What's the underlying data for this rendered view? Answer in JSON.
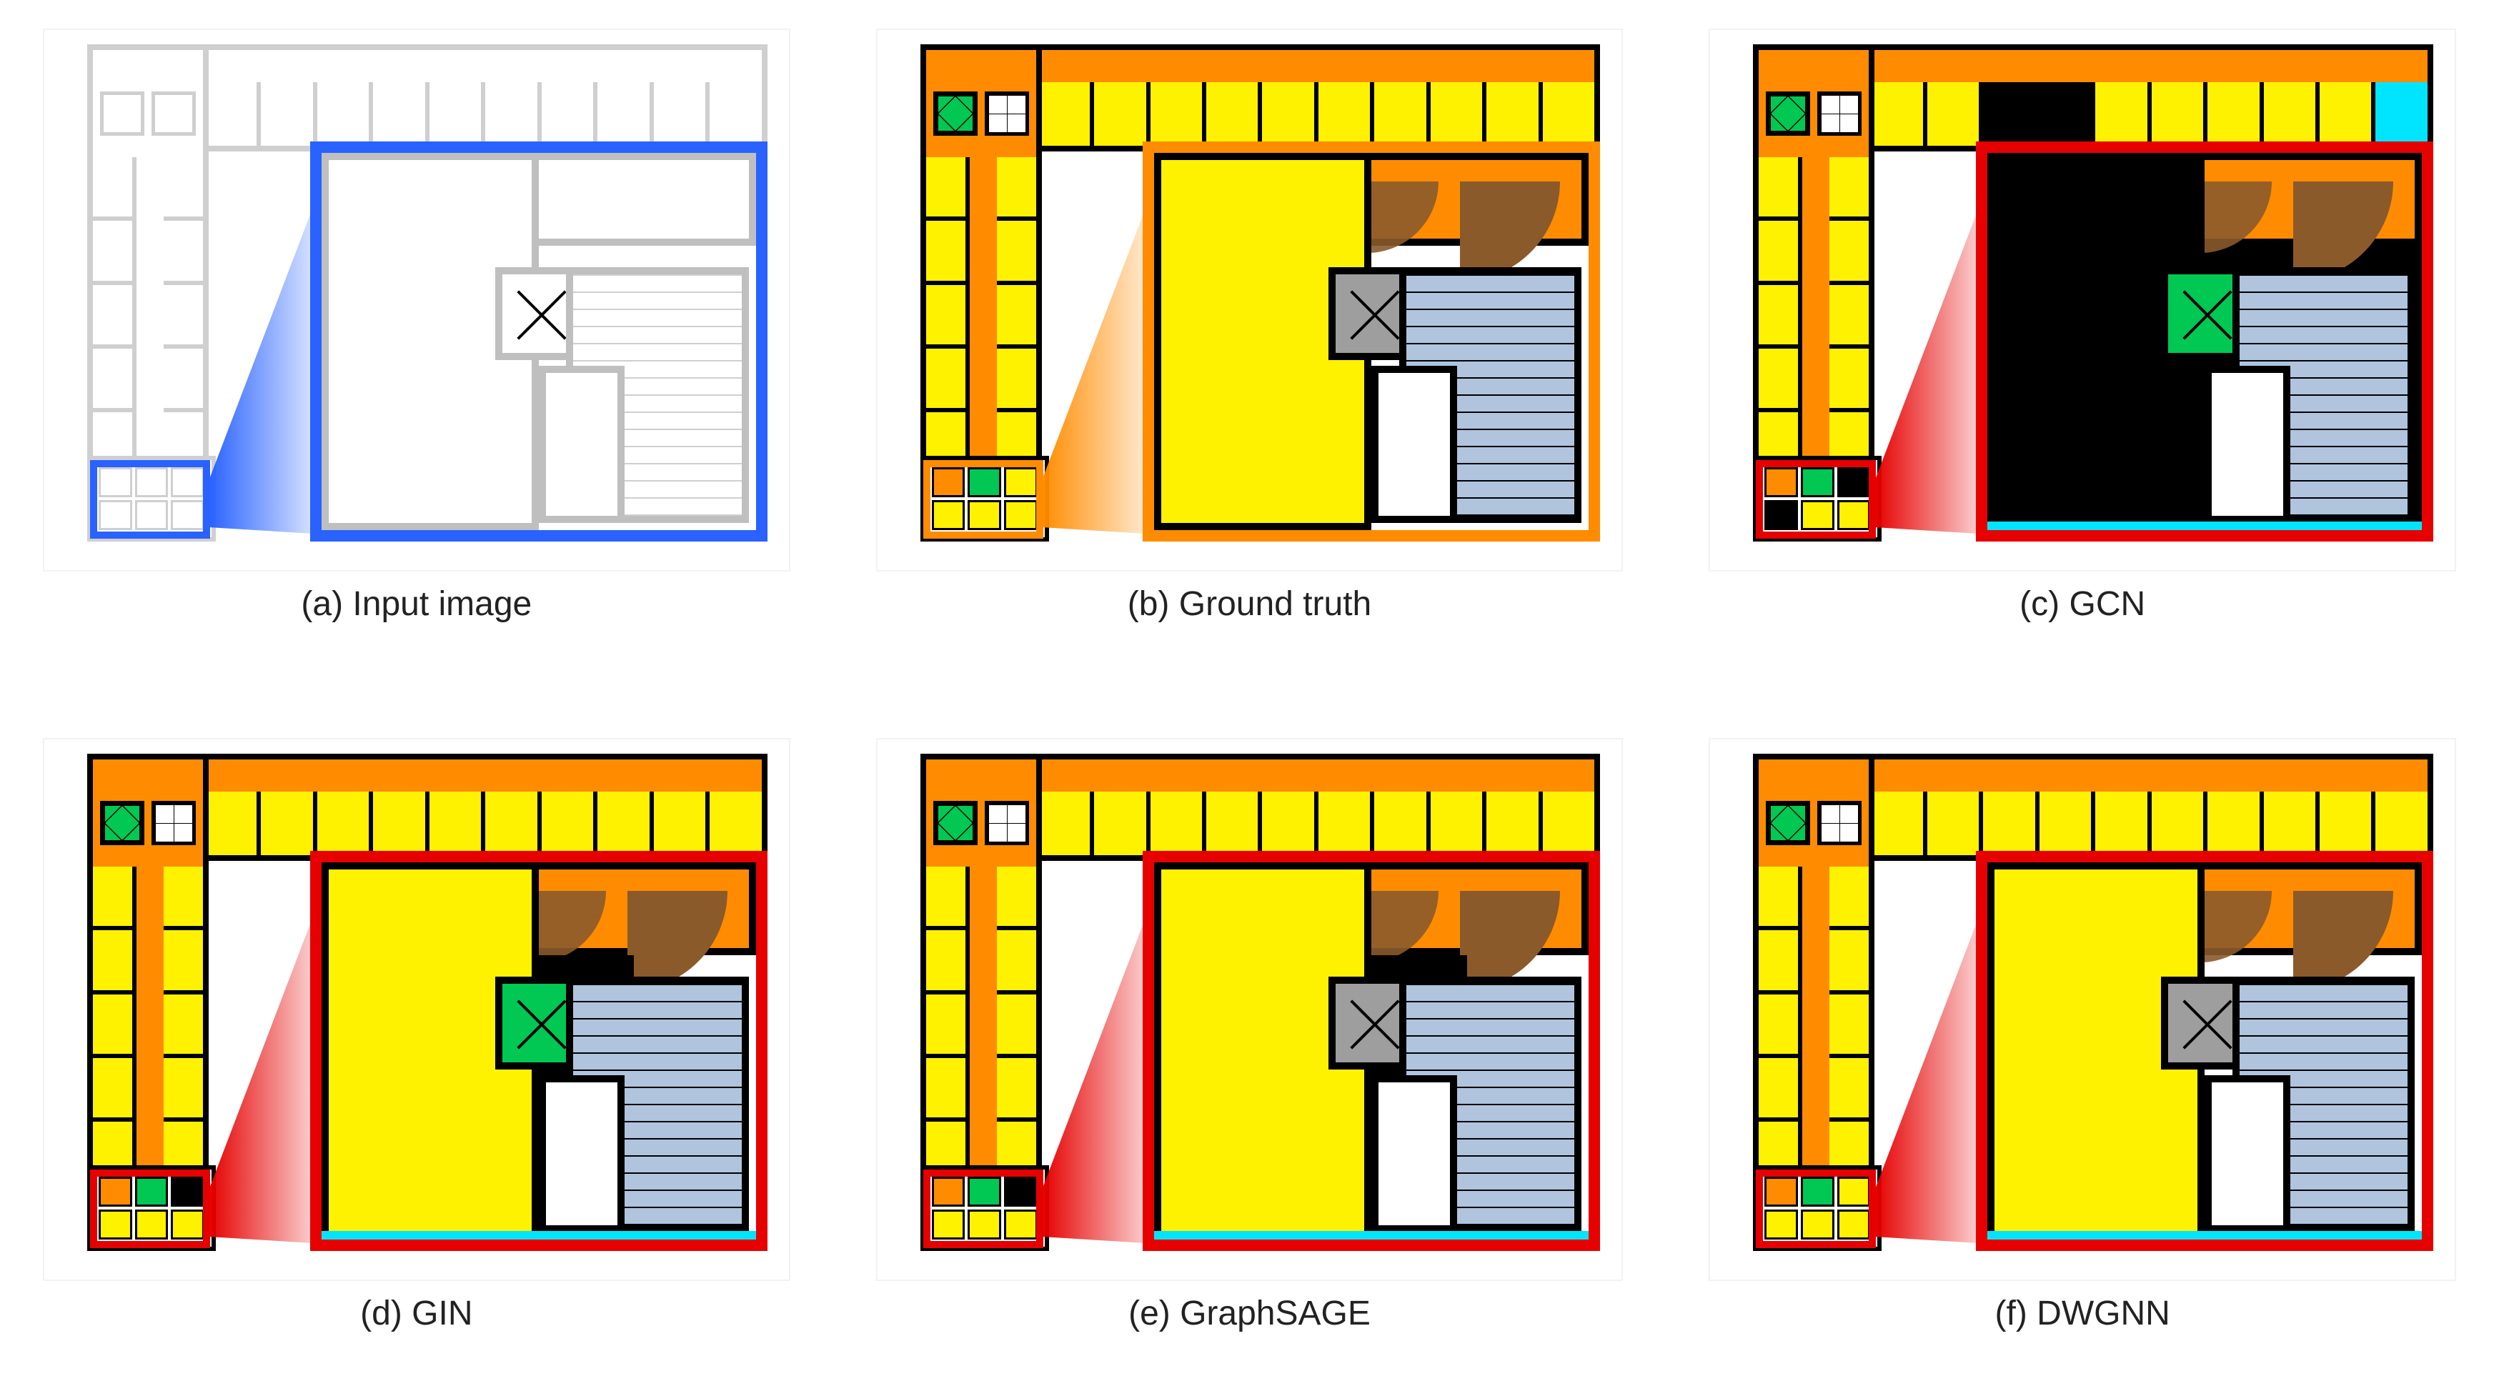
{
  "captions": {
    "a": "(a) Input image",
    "b": "(b) Ground truth",
    "c": "(c) GCN",
    "d": "(d) GIN",
    "e": "(e) GraphSAGE",
    "f": "(f) DWGNN"
  },
  "panels": {
    "a": {
      "variant": "lineart",
      "highlight_color": "blue",
      "wedge": "blue",
      "inset_border": "blue"
    },
    "b": {
      "variant": "color",
      "highlight_color": "orange",
      "wedge": "orange",
      "inset_border": "orange",
      "inset_left_room": "yellow",
      "inset_lift": "grey",
      "inset_right_fill": "none"
    },
    "c": {
      "variant": "color",
      "highlight_color": "red",
      "wedge": "red",
      "inset_border": "red",
      "inset_left_room": "black",
      "inset_lift": "green",
      "inset_right_fill": "black_full",
      "top_wing_black_slots": [
        4,
        5
      ]
    },
    "d": {
      "variant": "color",
      "highlight_color": "red",
      "wedge": "red",
      "inset_border": "red",
      "inset_left_room": "yellow",
      "inset_lift": "green",
      "inset_right_fill": "black_mid"
    },
    "e": {
      "variant": "color",
      "highlight_color": "red",
      "wedge": "red",
      "inset_border": "red",
      "inset_left_room": "yellow",
      "inset_lift": "grey",
      "inset_right_fill": "black_mid"
    },
    "f": {
      "variant": "color",
      "highlight_color": "red",
      "wedge": "red",
      "inset_border": "red",
      "inset_left_room": "yellow",
      "inset_lift": "grey",
      "inset_right_fill": "none"
    }
  },
  "legend_colors": {
    "room": "#fff200",
    "corridor": "#ff8c00",
    "elevator": "#00c853",
    "service": "#9e9e9e",
    "stairs": "#b0c4de",
    "wall": "#000000",
    "door_arc": "#8b5a2b",
    "accent": "#00e5ff",
    "unclassified": "#000000"
  }
}
